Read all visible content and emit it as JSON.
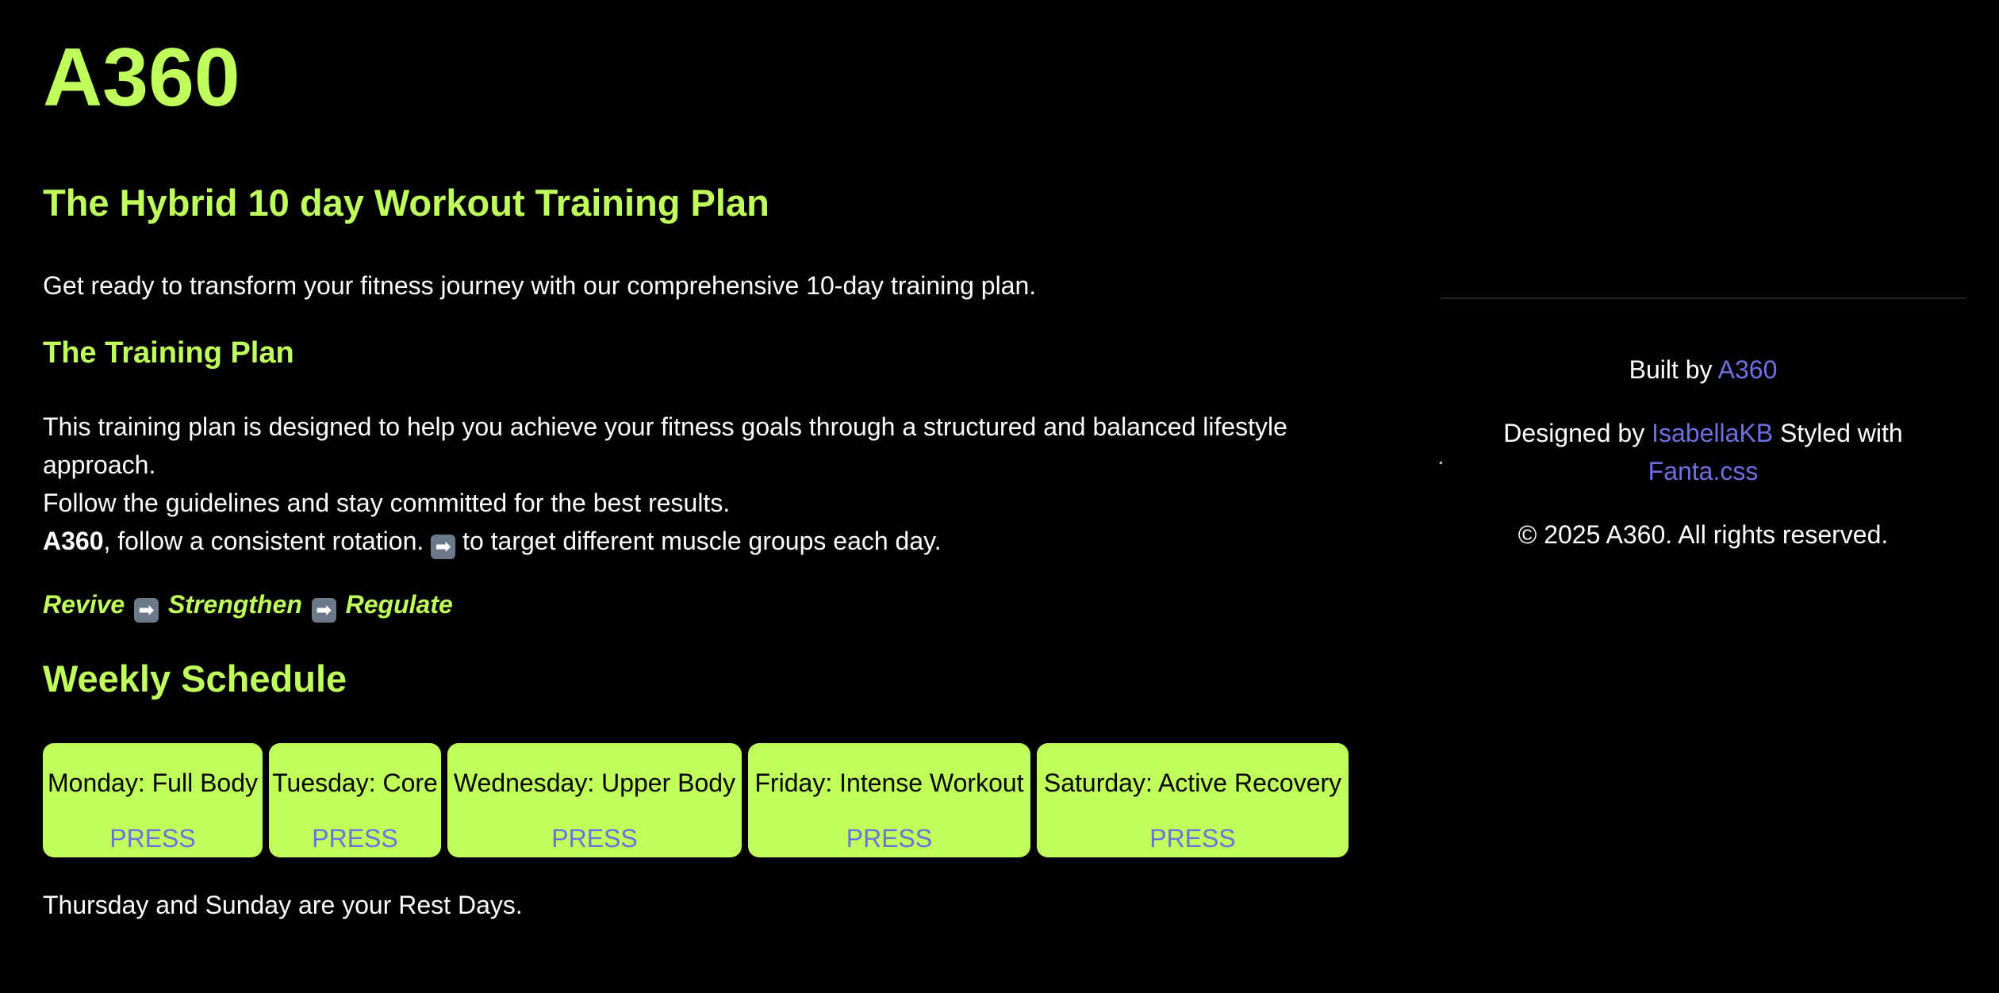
{
  "site": {
    "title": "A360"
  },
  "main": {
    "heading": "The Hybrid 10 day Workout Training Plan",
    "intro": "Get ready to transform your fitness journey with our comprehensive 10-day training plan.",
    "plan_heading": "The Training Plan",
    "plan_line1": "This training plan is designed to help you achieve your fitness goals through a structured and balanced lifestyle approach.",
    "plan_line2": "Follow the guidelines and stay committed for the best results.",
    "plan_line3_bold": "A360",
    "plan_line3_a": ", follow a consistent rotation.",
    "plan_line3_b": "to target different muscle groups each day.",
    "arrow_glyph": "➡",
    "flow": [
      "Revive",
      "Strengthen",
      "Regulate"
    ],
    "weekly_heading": "Weekly Schedule",
    "schedule": [
      {
        "day": "Monday: Full Body",
        "action": "PRESS"
      },
      {
        "day": "Tuesday: Core",
        "action": "PRESS"
      },
      {
        "day": "Wednesday: Upper Body",
        "action": "PRESS"
      },
      {
        "day": "Friday: Intense Workout",
        "action": "PRESS"
      },
      {
        "day": "Saturday: Active Recovery",
        "action": "PRESS"
      }
    ],
    "rest_note": "Thursday and Sunday are your Rest Days."
  },
  "footer": {
    "built_by_prefix": "Built by",
    "built_by_link": "A360",
    "designed_by_prefix": "Designed by",
    "designed_by_link": "IsabellaKB",
    "styled_with_text": "Styled with",
    "styled_with_link": "Fanta.css",
    "copyright": "© 2025 A360. All rights reserved."
  },
  "colors": {
    "background": "#000000",
    "accent": "#c0fe5c",
    "link": "#6f70e0",
    "text": "#ffffff"
  }
}
